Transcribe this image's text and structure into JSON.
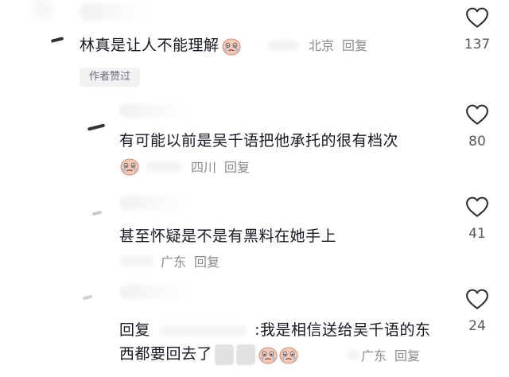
{
  "comments": [
    {
      "text": "林真是让人不能理解",
      "location": "北京",
      "reply_label": "回复",
      "likes": "137",
      "author_liked": "作者赞过"
    },
    {
      "text": "有可能以前是吴千语把他承托的很有档次",
      "location": "四川",
      "reply_label": "回复",
      "likes": "80"
    },
    {
      "text": "甚至怀疑是不是有黑料在她手上",
      "location": "广东",
      "reply_label": "回复",
      "likes": "41"
    },
    {
      "text_prefix": "回复",
      "text_body": ":我是相信送给吴千语的东",
      "text_line2": "西都要回去了",
      "location": "广东",
      "reply_label": "回复",
      "likes": "24"
    }
  ],
  "icons": {
    "like": "heart-outline-icon",
    "emoji": "crying-face-emoji"
  },
  "colors": {
    "text": "#161823",
    "meta": "#8a8b91",
    "badge_bg": "#f2f2f4"
  }
}
